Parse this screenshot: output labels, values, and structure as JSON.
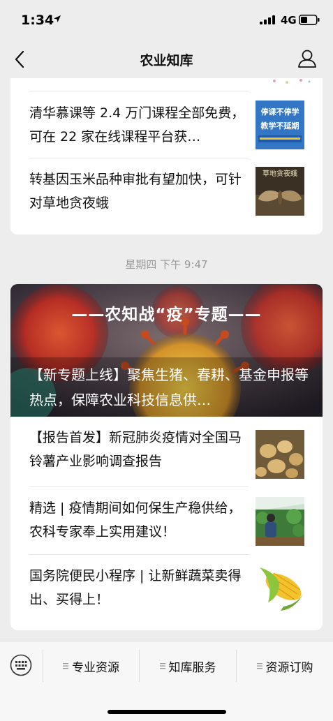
{
  "status": {
    "time": "1:34",
    "network": "4G"
  },
  "nav": {
    "title": "农业知库"
  },
  "feed": {
    "card1": {
      "articles": [
        {
          "title": "清华慕课等 2.4 万门课程全部免费，可在 22 家在线课程平台获…",
          "thumb_caption": "停课不停学\n教学不延期"
        },
        {
          "title": "转基因玉米品种审批有望加快，可针对草地贪夜蛾",
          "thumb_caption": "草地贪夜蛾"
        }
      ]
    },
    "timestamp": "星期四 下午 9:47",
    "card2": {
      "banner_heading": "——农知战“疫”专题——",
      "banner_title": "【新专题上线】聚焦生猪、春耕、基金申报等热点，保障农业科技信息供…",
      "articles": [
        {
          "title": "【报告首发】新冠肺炎疫情对全国马铃薯产业影响调查报告"
        },
        {
          "title": "精选 | 疫情期间如何保生产稳供给，农科专家奉上实用建议！"
        },
        {
          "title": "国务院便民小程序 | 让新鲜蔬菜卖得出、买得上！"
        }
      ]
    }
  },
  "menu": [
    {
      "label": "专业资源"
    },
    {
      "label": "知库服务"
    },
    {
      "label": "资源订购"
    }
  ],
  "colors": {
    "background": "#ededed",
    "card": "#ffffff",
    "timestamp": "#999999",
    "accent_blue": "#2b6fc0"
  }
}
